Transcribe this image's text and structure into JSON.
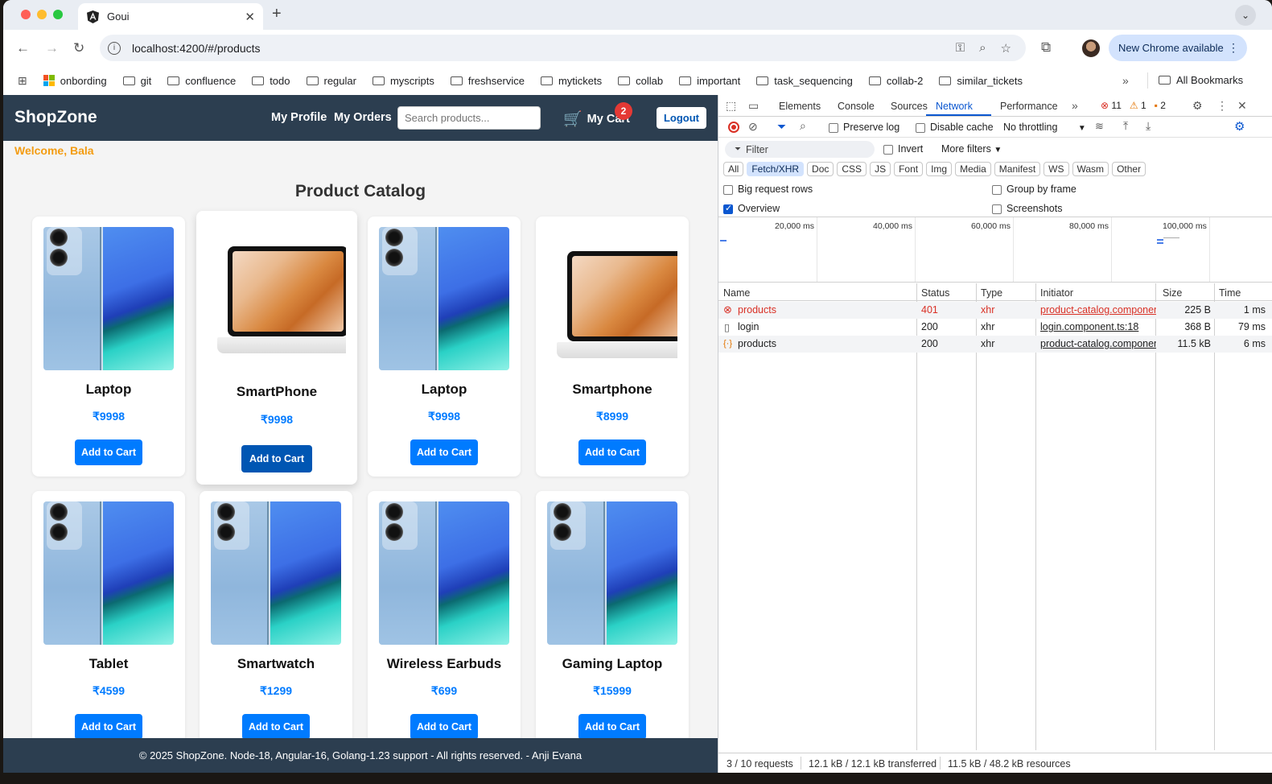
{
  "browser": {
    "tab_title": "Goui",
    "url": "localhost:4200/#/products",
    "update_label": "New Chrome available",
    "bookmarks": [
      "onbording",
      "git",
      "confluence",
      "todo",
      "regular",
      "myscripts",
      "freshservice",
      "mytickets",
      "collab",
      "important",
      "task_sequencing",
      "collab-2",
      "similar_tickets"
    ],
    "all_bookmarks": "All Bookmarks"
  },
  "app": {
    "brand": "ShopZone",
    "nav_profile": "My Profile",
    "nav_orders": "My Orders",
    "search_placeholder": "Search products...",
    "cart_label": "My Cart",
    "cart_count": "2",
    "logout": "Logout",
    "welcome": "Welcome, Bala",
    "catalog_title": "Product Catalog",
    "add_to_cart": "Add to Cart",
    "products": [
      {
        "name": "Laptop",
        "price": "₹9998",
        "image": "phone"
      },
      {
        "name": "SmartPhone",
        "price": "₹9998",
        "image": "laptop"
      },
      {
        "name": "Laptop",
        "price": "₹9998",
        "image": "phone"
      },
      {
        "name": "Smartphone",
        "price": "₹8999",
        "image": "laptop"
      },
      {
        "name": "Tablet",
        "price": "₹4599",
        "image": "phone"
      },
      {
        "name": "Smartwatch",
        "price": "₹1299",
        "image": "phone"
      },
      {
        "name": "Wireless Earbuds",
        "price": "₹699",
        "image": "phone"
      },
      {
        "name": "Gaming Laptop",
        "price": "₹15999",
        "image": "phone"
      }
    ],
    "footer": "© 2025 ShopZone. Node-18, Angular-16, Golang-1.23 support - All rights reserved. - Anji Evana"
  },
  "devtools": {
    "tabs": [
      "Elements",
      "Console",
      "Sources",
      "Network",
      "Performance"
    ],
    "active_tab": "Network",
    "errors": "11",
    "warnings": "1",
    "issues": "2",
    "preserve_log": "Preserve log",
    "disable_cache": "Disable cache",
    "throttling": "No throttling",
    "filter_placeholder": "Filter",
    "invert": "Invert",
    "more_filters": "More filters",
    "type_filters": [
      "All",
      "Fetch/XHR",
      "Doc",
      "CSS",
      "JS",
      "Font",
      "Img",
      "Media",
      "Manifest",
      "WS",
      "Wasm",
      "Other"
    ],
    "selected_filter": "Fetch/XHR",
    "big_request_rows": "Big request rows",
    "group_by_frame": "Group by frame",
    "overview": "Overview",
    "screenshots": "Screenshots",
    "timeline_labels": [
      "20,000 ms",
      "40,000 ms",
      "60,000 ms",
      "80,000 ms",
      "100,000 ms"
    ],
    "columns": [
      "Name",
      "Status",
      "Type",
      "Initiator",
      "Size",
      "Time"
    ],
    "requests": [
      {
        "name": "products",
        "status": "401",
        "type": "xhr",
        "initiator": "product-catalog.component.ts",
        "size": "225 B",
        "time": "1 ms",
        "error": true
      },
      {
        "name": "login",
        "status": "200",
        "type": "xhr",
        "initiator": "login.component.ts:18",
        "size": "368 B",
        "time": "79 ms",
        "error": false
      },
      {
        "name": "products",
        "status": "200",
        "type": "xhr",
        "initiator": "product-catalog.component.ts",
        "size": "11.5 kB",
        "time": "6 ms",
        "error": false
      }
    ],
    "status_requests": "3 / 10 requests",
    "status_transferred": "12.1 kB / 12.1 kB transferred",
    "status_resources": "11.5 kB / 48.2 kB resources"
  }
}
